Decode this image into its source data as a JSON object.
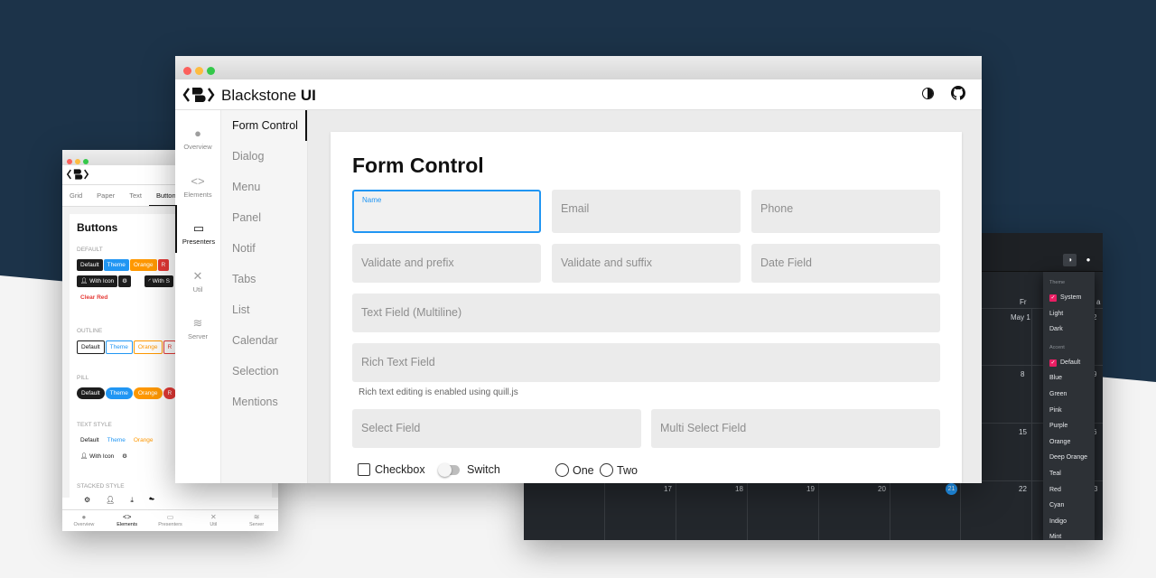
{
  "colors": {
    "accent": "#2196f3",
    "background_dark": "#1c3349",
    "pink_accent": "#e91e63"
  },
  "main_window": {
    "title_plain": "Blackstone ",
    "title_bold": "UI",
    "icons": {
      "theme": "theme-toggle-icon",
      "github": "github-icon"
    },
    "rail": [
      {
        "label": "Overview",
        "icon": "info-icon"
      },
      {
        "label": "Elements",
        "icon": "code-icon"
      },
      {
        "label": "Presenters",
        "icon": "window-icon"
      },
      {
        "label": "Util",
        "icon": "tools-icon"
      },
      {
        "label": "Server",
        "icon": "database-icon"
      }
    ],
    "nav": [
      "Form Control",
      "Dialog",
      "Menu",
      "Panel",
      "Notif",
      "Tabs",
      "List",
      "Calendar",
      "Selection",
      "Mentions"
    ],
    "page_title": "Form Control",
    "fields": {
      "name": "Name",
      "email": "Email",
      "phone": "Phone",
      "validate_prefix": "Validate and prefix",
      "validate_suffix": "Validate and suffix",
      "date": "Date Field",
      "multiline": "Text Field (Multiline)",
      "rich": "Rich Text Field",
      "rich_hint": "Rich text editing is enabled using quill.js",
      "select": "Select Field",
      "multi_select": "Multi Select Field"
    },
    "controls": {
      "checkbox": "Checkbox",
      "switch": "Switch",
      "radio_one": "One",
      "radio_two": "Two"
    }
  },
  "left_window": {
    "tabs": [
      "Grid",
      "Paper",
      "Text",
      "Buttons"
    ],
    "title": "Buttons",
    "sections": {
      "default": "DEFAULT",
      "outline": "OUTLINE",
      "pill": "PILL",
      "text_style": "TEXT STYLE",
      "stacked": "STACKED STYLE"
    },
    "btn": {
      "default": "Default",
      "theme": "Theme",
      "orange": "Orange",
      "red": "R",
      "with_icon": "With Icon",
      "with_short": "With S",
      "clear_red": "Clear Red",
      "with_icon2": "With Icon"
    },
    "bottom_nav": [
      "Overview",
      "Elements",
      "Presenters",
      "Util",
      "Server"
    ]
  },
  "right_window": {
    "weekday_fr": "Fr",
    "weekday_sa_partial": "a",
    "days": {
      "may1": "May 1",
      "d2": "2",
      "d8": "8",
      "d9": "9",
      "d15": "15",
      "d16": "6",
      "d17": "17",
      "d18": "18",
      "d19": "19",
      "d20": "20",
      "d21": "21",
      "d22": "22",
      "d23": "3"
    },
    "menu": {
      "theme_header": "Theme",
      "theme_items": [
        "System",
        "Light",
        "Dark"
      ],
      "accent_header": "Accent",
      "accent_items": [
        "Default",
        "Blue",
        "Green",
        "Pink",
        "Purple",
        "Orange",
        "Deep Orange",
        "Teal",
        "Red",
        "Cyan",
        "Indigo",
        "Mint"
      ]
    }
  }
}
